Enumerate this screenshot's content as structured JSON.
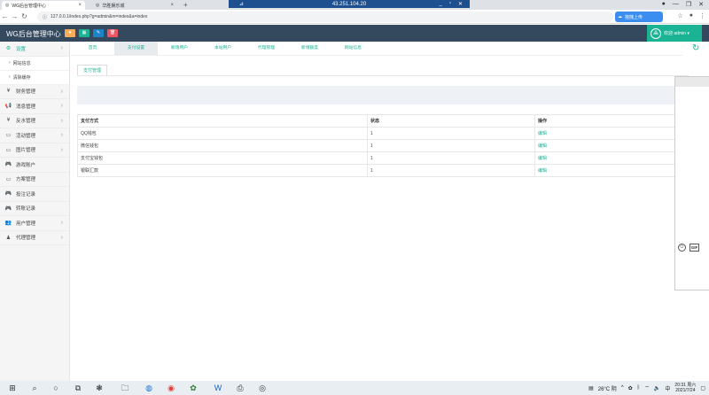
{
  "browser": {
    "tabs": [
      {
        "title": "WG后台管理中心",
        "active": true
      },
      {
        "title": "华胜娱乐城",
        "active": false
      }
    ],
    "new_tab": "+",
    "remote_host": "43.251.104.20",
    "url": "127.0.0.1/index.php?g=admin&m=index&a=index",
    "upload_label": "拖拽上传"
  },
  "header": {
    "brand": "WG后台管理中心",
    "user_label": "欢迎 admin ▾"
  },
  "sidebar": {
    "items": [
      {
        "label": "设置",
        "icon": "gear-icon",
        "glyph": "⚙",
        "active": true
      },
      {
        "label": "网站信息",
        "sub": true
      },
      {
        "label": "清除缓存",
        "sub": true
      },
      {
        "label": "财务管理",
        "icon": "yen-icon",
        "glyph": "¥"
      },
      {
        "label": "消息管理",
        "icon": "megaphone-icon",
        "glyph": "📢"
      },
      {
        "label": "反水管理",
        "icon": "yen-icon",
        "glyph": "¥"
      },
      {
        "label": "活动管理",
        "icon": "monitor-icon",
        "glyph": "▭"
      },
      {
        "label": "图片管理",
        "icon": "monitor-icon",
        "glyph": "▭"
      },
      {
        "label": "游戏账户",
        "icon": "gamepad-icon",
        "glyph": "🎮"
      },
      {
        "label": "方案管理",
        "icon": "monitor-icon",
        "glyph": "▭"
      },
      {
        "label": "投注记录",
        "icon": "gamepad-icon",
        "glyph": "🎮"
      },
      {
        "label": "转账记录",
        "icon": "gamepad-icon",
        "glyph": "🎮"
      },
      {
        "label": "用户管理",
        "icon": "users-icon",
        "glyph": "👥"
      },
      {
        "label": "代理管理",
        "icon": "person-icon",
        "glyph": "♟"
      }
    ]
  },
  "top_tabs": [
    "首页",
    "支付设置",
    "新增用户",
    "本站用户",
    "代理管理",
    "新增额度",
    "网站信息"
  ],
  "breadcrumb_tab": "支付管理",
  "table": {
    "headers": [
      "支付方式",
      "状态",
      "操作"
    ],
    "rows": [
      {
        "method": "QQ钱包",
        "status": "1",
        "op": "编辑"
      },
      {
        "method": "微信钱包",
        "status": "1",
        "op": "编辑"
      },
      {
        "method": "支付宝钱包",
        "status": "1",
        "op": "编辑"
      },
      {
        "method": "银联汇款",
        "status": "1",
        "op": "编辑"
      }
    ]
  },
  "taskbar": {
    "weather": "26°C 阴",
    "time": "20:31 周六",
    "date": "2021/7/24"
  },
  "colors": {
    "header_bg": "#34495e",
    "accent": "#1ab394",
    "btn_yellow": "#f8ac59",
    "btn_green": "#1ab394",
    "btn_blue": "#1c84c6",
    "btn_red": "#ed5565"
  }
}
